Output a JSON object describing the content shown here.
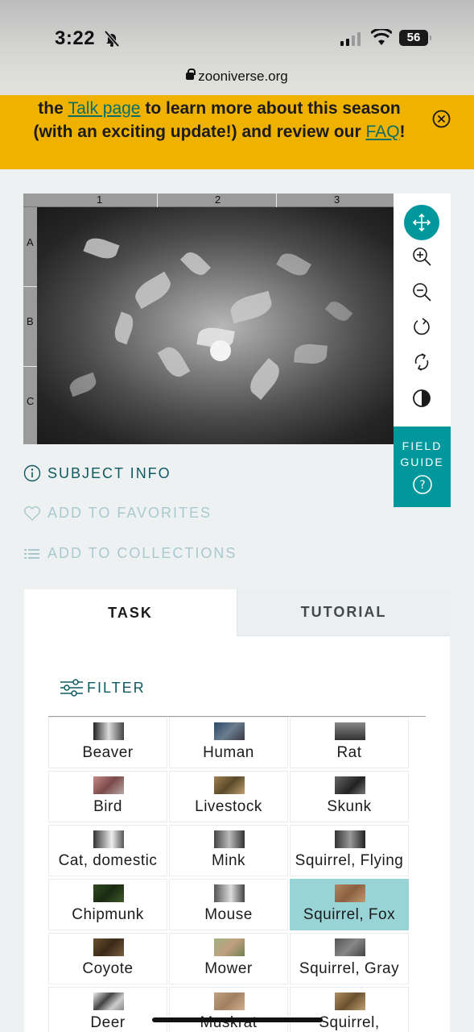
{
  "status": {
    "time": "3:22",
    "battery": "56",
    "url": "zooniverse.org"
  },
  "banner": {
    "line1_pre": "the ",
    "talk_link": "Talk page",
    "line1_post": " to learn more about this season (with an exciting update!) and review our ",
    "faq_link": "FAQ",
    "end": "!"
  },
  "viewer": {
    "columns": [
      "1",
      "2",
      "3"
    ],
    "rows": [
      "A",
      "B",
      "C"
    ],
    "tools": [
      "move-icon",
      "zoom-in-icon",
      "zoom-out-icon",
      "rotate-icon",
      "reset-icon",
      "invert-icon"
    ],
    "field_guide_label": "FIELD GUIDE"
  },
  "links": {
    "subject_info": "SUBJECT INFO",
    "add_favorites": "ADD TO FAVORITES",
    "add_collections": "ADD TO COLLECTIONS"
  },
  "panel": {
    "tab_task": "TASK",
    "tab_tutorial": "TUTORIAL",
    "filter": "FILTER",
    "choices": [
      [
        "Beaver",
        "Human",
        "Rat"
      ],
      [
        "Bird",
        "Livestock",
        "Skunk"
      ],
      [
        "Cat, domestic",
        "Mink",
        "Squirrel, Flying"
      ],
      [
        "Chipmunk",
        "Mouse",
        "Squirrel, Fox"
      ],
      [
        "Coyote",
        "Mower",
        "Squirrel, Gray"
      ],
      [
        "Deer",
        "Muskrat",
        "Squirrel,"
      ]
    ],
    "selected": "Squirrel, Fox"
  },
  "colors": {
    "accent": "#00979d",
    "banner": "#f0b200",
    "selected": "#98d3d6"
  }
}
